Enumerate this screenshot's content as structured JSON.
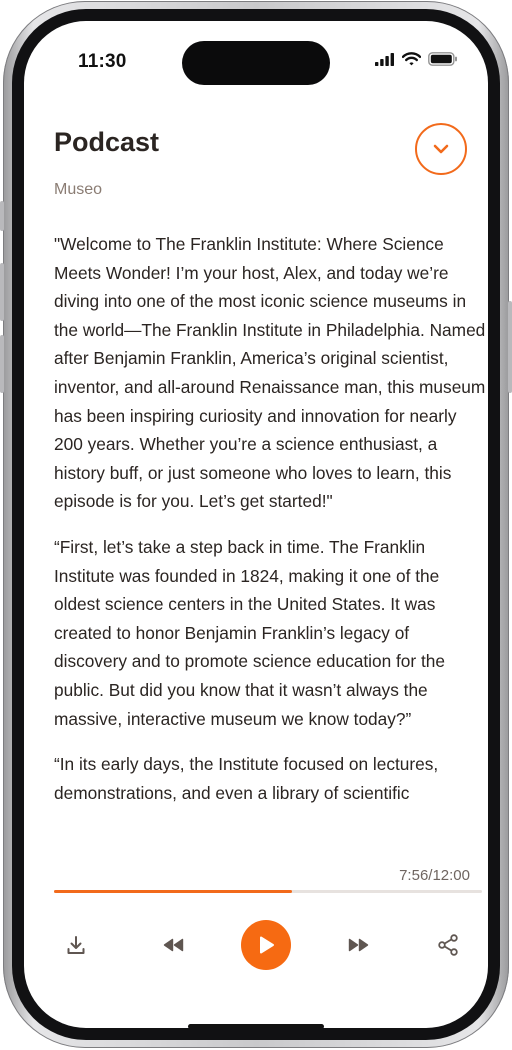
{
  "status_bar": {
    "time": "11:30",
    "icons": [
      "signal-icon",
      "wifi-icon",
      "battery-icon"
    ]
  },
  "header": {
    "title": "Podcast",
    "subtitle": "Museo",
    "collapse_icon": "chevron-down-icon"
  },
  "transcript": {
    "paragraphs": [
      "\"Welcome to The Franklin Institute: Where Science Meets Wonder! I’m your host, Alex, and today we’re diving into one of the most iconic science museums in the world—The Franklin Institute in Philadelphia. Named after Benjamin Franklin, America’s original scientist, inventor, and all-around Renaissance man, this museum has been inspiring curiosity and innovation for nearly 200 years. Whether you’re a science enthusiast, a history buff, or just someone who loves to learn, this episode is for you. Let’s get started!\"",
      "“First, let’s take a step back in time. The Franklin Institute was founded in 1824, making it one of the oldest science centers in the United States. It was created to honor Benjamin Franklin’s legacy of discovery and to promote science education for the public. But did you know that it wasn’t always the massive, interactive museum we know today?”",
      "“In its early days, the Institute focused on lectures, demonstrations, and even a library of scientific"
    ]
  },
  "player": {
    "time_label": "7:56/12:00",
    "progress": 0.556,
    "controls": [
      {
        "name": "download-button",
        "icon": "download-icon"
      },
      {
        "name": "rewind-button",
        "icon": "rewind-icon"
      },
      {
        "name": "play-button",
        "icon": "play-icon"
      },
      {
        "name": "fast-forward-button",
        "icon": "fast-forward-icon"
      },
      {
        "name": "share-button",
        "icon": "share-icon"
      }
    ]
  },
  "colors": {
    "accent": "#f26a1b",
    "text": "#2b2522",
    "muted": "#8a7c73"
  }
}
